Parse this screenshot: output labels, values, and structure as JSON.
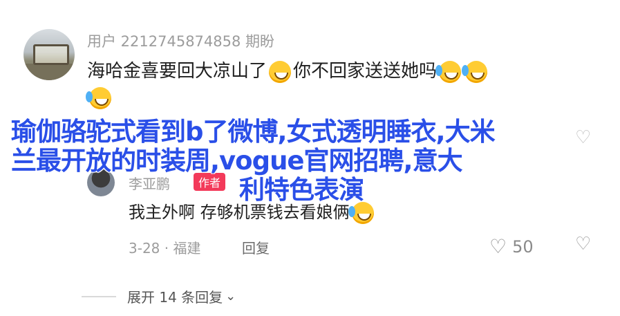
{
  "comment": {
    "username": "用户 2212745874858 期盼",
    "text_part1": "海哈金喜要回大凉山了",
    "text_part2": "你不回家送送她吗"
  },
  "overlay_text": {
    "line1": "瑜伽骆驼式看到b了微博,女式透明睡衣,大米",
    "line2": "兰最开放的时装周,vogue官网招聘,意大",
    "line3": "利特色表演"
  },
  "reply": {
    "username": "李亚鹏",
    "badge": "作者",
    "text": "我主外啊 存够机票钱去看娘俩",
    "date_location": "3-28 · 福建",
    "reply_label": "回复",
    "like_count": "50"
  },
  "expand": {
    "label": "展开 14 条回复"
  },
  "icons": {
    "like": "heart-outline-icon",
    "dislike": "broken-heart-icon",
    "expand": "chevron-down-icon"
  }
}
